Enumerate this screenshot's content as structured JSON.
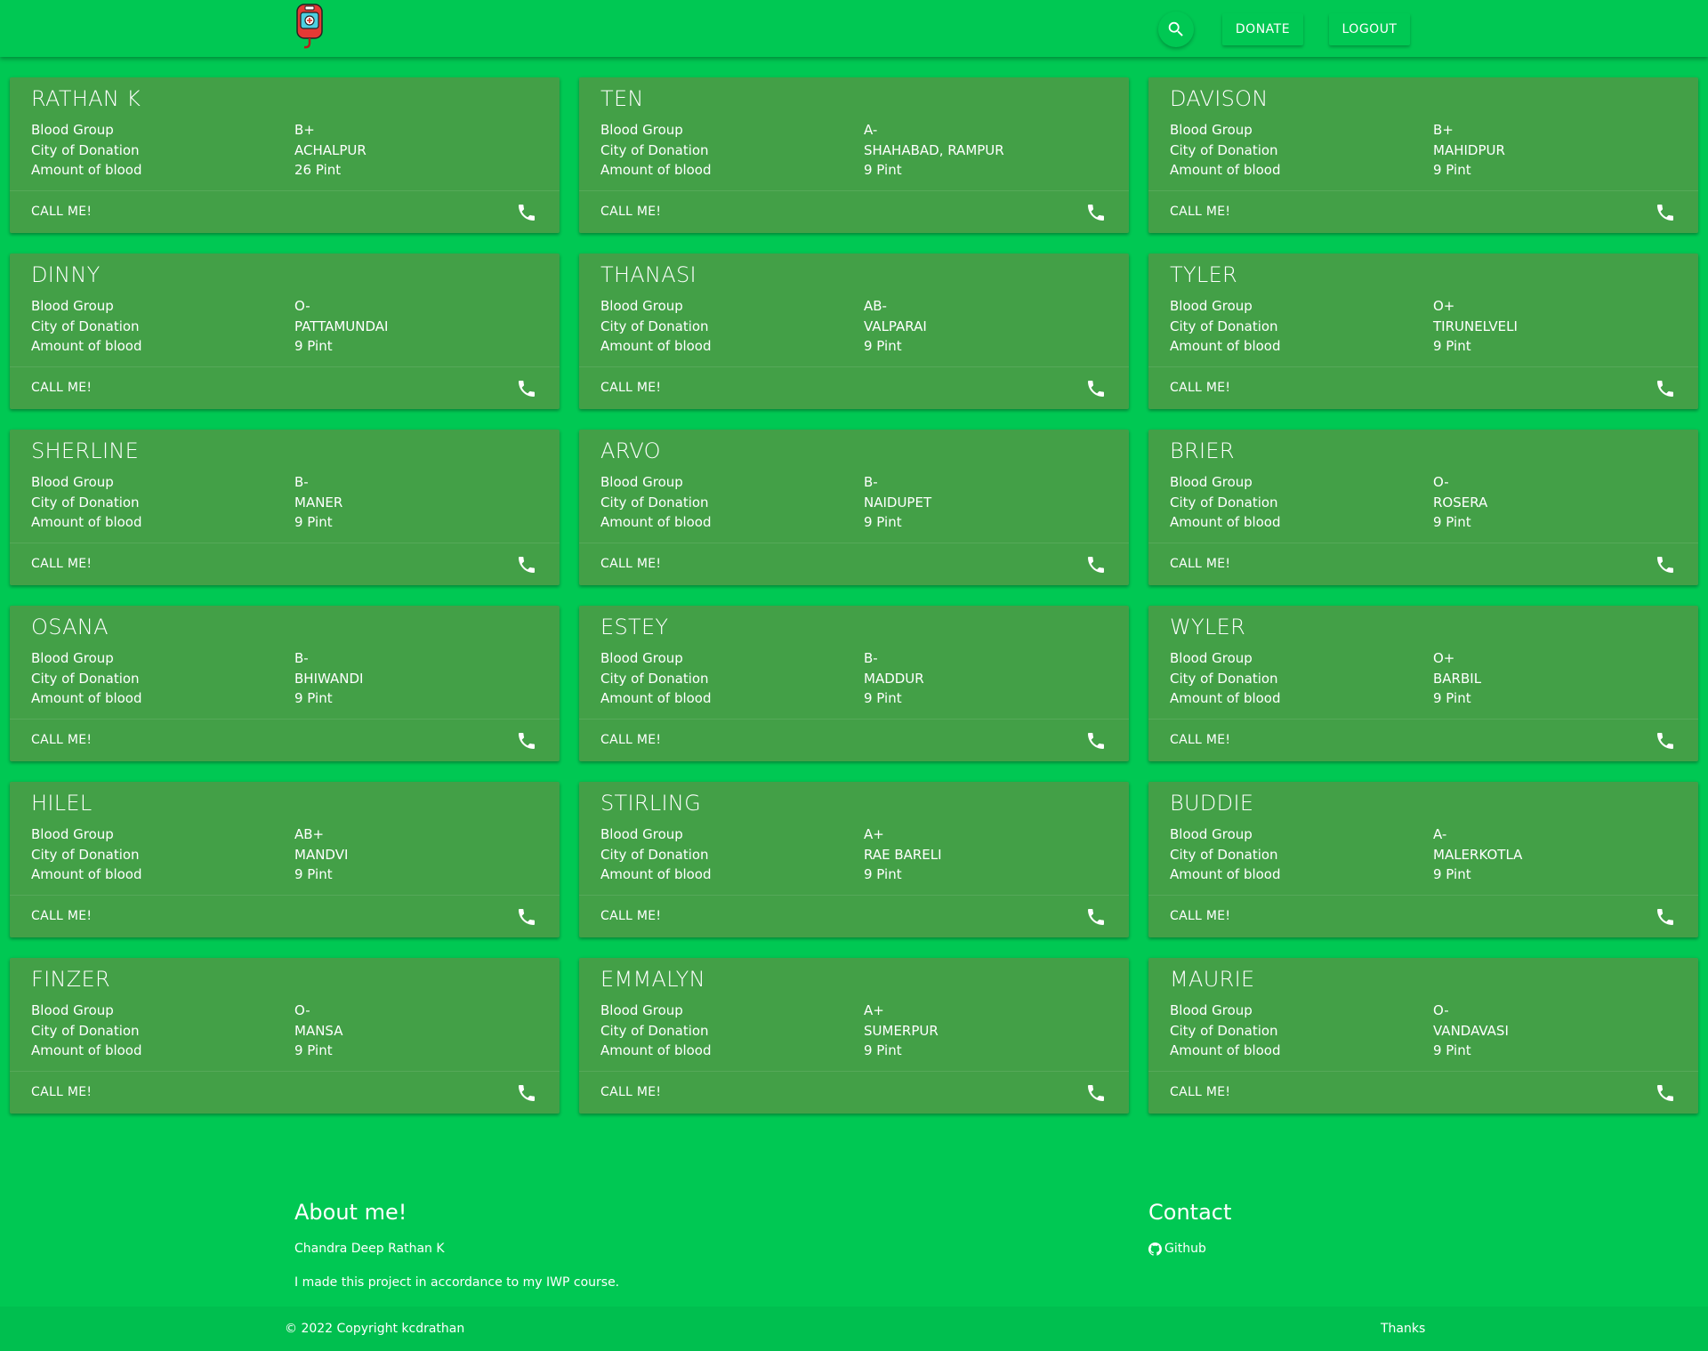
{
  "colors": {
    "background": "#00c853",
    "card": "#43a047",
    "text": "#ffffff",
    "logo_bag": "#e53935"
  },
  "navbar": {
    "logo_icon": "blood-bag-icon",
    "search_icon": "search-icon",
    "donate_label": "DONATE",
    "logout_label": "LOGOUT"
  },
  "card_labels": {
    "blood_group": "Blood Group",
    "city": "City of Donation",
    "amount": "Amount of blood",
    "call": "CALL ME!",
    "call_icon": "phone-icon"
  },
  "donors": [
    {
      "name": "RATHAN K",
      "blood_group": "B+",
      "city": "ACHALPUR",
      "amount": "26 Pint"
    },
    {
      "name": "TEN",
      "blood_group": "A-",
      "city": "SHAHABAD, RAMPUR",
      "amount": "9 Pint"
    },
    {
      "name": "DAVISON",
      "blood_group": "B+",
      "city": "MAHIDPUR",
      "amount": "9 Pint"
    },
    {
      "name": "DINNY",
      "blood_group": "O-",
      "city": "PATTAMUNDAI",
      "amount": "9 Pint"
    },
    {
      "name": "THANASI",
      "blood_group": "AB-",
      "city": "VALPARAI",
      "amount": "9 Pint"
    },
    {
      "name": "TYLER",
      "blood_group": "O+",
      "city": "TIRUNELVELI",
      "amount": "9 Pint"
    },
    {
      "name": "SHERLINE",
      "blood_group": "B-",
      "city": "MANER",
      "amount": "9 Pint"
    },
    {
      "name": "ARVO",
      "blood_group": "B-",
      "city": "NAIDUPET",
      "amount": "9 Pint"
    },
    {
      "name": "BRIER",
      "blood_group": "O-",
      "city": "ROSERA",
      "amount": "9 Pint"
    },
    {
      "name": "OSANA",
      "blood_group": "B-",
      "city": "BHIWANDI",
      "amount": "9 Pint"
    },
    {
      "name": "ESTEY",
      "blood_group": "B-",
      "city": "MADDUR",
      "amount": "9 Pint"
    },
    {
      "name": "WYLER",
      "blood_group": "O+",
      "city": "BARBIL",
      "amount": "9 Pint"
    },
    {
      "name": "HILEL",
      "blood_group": "AB+",
      "city": "MANDVI",
      "amount": "9 Pint"
    },
    {
      "name": "STIRLING",
      "blood_group": "A+",
      "city": "RAE BARELI",
      "amount": "9 Pint"
    },
    {
      "name": "BUDDIE",
      "blood_group": "A-",
      "city": "MALERKOTLA",
      "amount": "9 Pint"
    },
    {
      "name": "FINZER",
      "blood_group": "O-",
      "city": "MANSA",
      "amount": "9 Pint"
    },
    {
      "name": "EMMALYN",
      "blood_group": "A+",
      "city": "SUMERPUR",
      "amount": "9 Pint"
    },
    {
      "name": "MAURIE",
      "blood_group": "O-",
      "city": "VANDAVASI",
      "amount": "9 Pint"
    }
  ],
  "footer": {
    "about_title": "About me!",
    "author": "Chandra Deep Rathan K",
    "description": "I made this project in accordance to my IWP course.",
    "contact_title": "Contact",
    "github_icon": "github-icon",
    "github_label": "Github",
    "copyright": "© 2022 Copyright kcdrathan",
    "thanks": "Thanks"
  }
}
